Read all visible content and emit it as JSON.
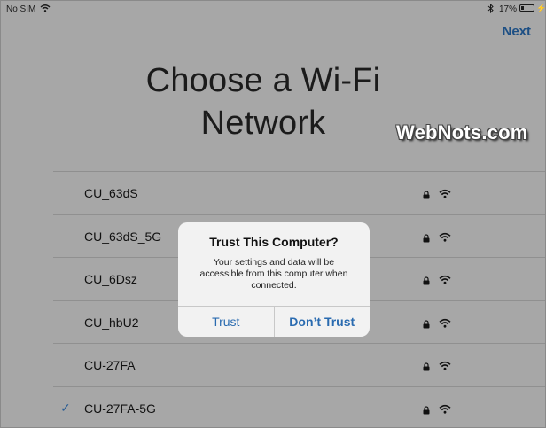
{
  "status_bar": {
    "carrier": "No SIM",
    "battery_percent": "17%",
    "battery_level": 0.17
  },
  "header": {
    "next_label": "Next",
    "title_line1": "Choose a Wi-Fi",
    "title_line2": "Network"
  },
  "watermark": "WebNots.com",
  "networks": [
    {
      "name": "CU_63dS",
      "secured": true,
      "selected": false
    },
    {
      "name": "CU_63dS_5G",
      "secured": true,
      "selected": false
    },
    {
      "name": "CU_6Dsz",
      "secured": true,
      "selected": false
    },
    {
      "name": "CU_hbU2",
      "secured": true,
      "selected": false
    },
    {
      "name": "CU-27FA",
      "secured": true,
      "selected": false
    },
    {
      "name": "CU-27FA-5G",
      "secured": true,
      "selected": true
    }
  ],
  "icons": {
    "check": "checkmark-icon",
    "lock": "lock-icon",
    "wifi": "wifi-icon",
    "bluetooth": "bluetooth-icon",
    "battery": "battery-icon"
  },
  "alert": {
    "title": "Trust This Computer?",
    "message": "Your settings and data will be accessible from this computer when connected.",
    "trust_label": "Trust",
    "dont_trust_label": "Don’t Trust"
  },
  "colors": {
    "dimmed_background": "#a7a7a7",
    "accent": "#2a6bb0",
    "alert_background": "#f2f2f2"
  }
}
